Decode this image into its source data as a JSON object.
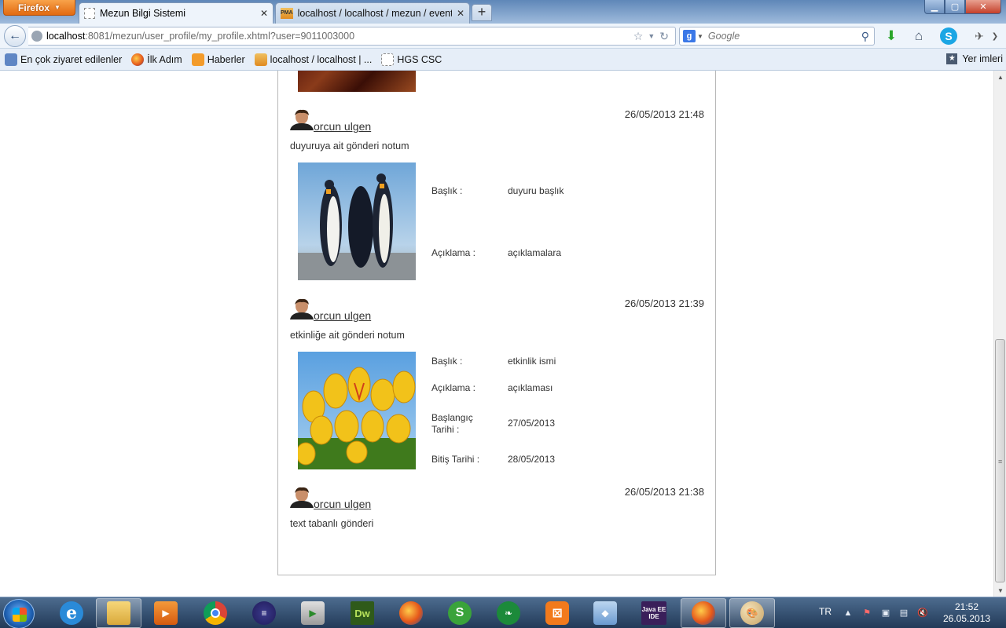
{
  "browser": {
    "firefox_label": "Firefox",
    "tabs": [
      {
        "title": "Mezun Bilgi Sistemi",
        "active": true
      },
      {
        "title": "localhost / localhost / mezun / event ...",
        "active": false
      }
    ],
    "url_host": "localhost",
    "url_rest": ":8081/mezun/user_profile/my_profile.xhtml?user=9011003000",
    "search_placeholder": "Google",
    "bookmarks": [
      {
        "label": "En çok ziyaret edilenler",
        "icon": "most-visited-icon"
      },
      {
        "label": "İlk Adım",
        "icon": "firefox-icon"
      },
      {
        "label": "Haberler",
        "icon": "rss-icon"
      },
      {
        "label": "localhost / localhost | ...",
        "icon": "phpmyadmin-icon"
      },
      {
        "label": "HGS CSC",
        "icon": "blank-page-icon"
      }
    ],
    "bookmarks_menu": "Yer imleri"
  },
  "feed": {
    "posts": [
      {
        "author": "orcun ulgen",
        "timestamp": "26/05/2013 21:48",
        "text": "duyuruya ait gönderi notum",
        "image": "penguins",
        "fields": [
          {
            "label": "Başlık :",
            "value": "duyuru başlık"
          },
          {
            "label": "Açıklama :",
            "value": "açıklamalara"
          }
        ]
      },
      {
        "author": "orcun ulgen",
        "timestamp": "26/05/2013 21:39",
        "text": "etkinliğe ait gönderi notum",
        "image": "tulips",
        "fields": [
          {
            "label": "Başlık :",
            "value": "etkinlik ismi"
          },
          {
            "label": "Açıklama :",
            "value": "açıklaması"
          },
          {
            "label": "Başlangıç Tarihi :",
            "value": "27/05/2013"
          },
          {
            "label": "Bitiş Tarihi :",
            "value": "28/05/2013"
          }
        ]
      },
      {
        "author": "orcun ulgen",
        "timestamp": "26/05/2013 21:38",
        "text": "text tabanlı gönderi"
      }
    ]
  },
  "taskbar": {
    "language": "TR",
    "time": "21:52",
    "date": "26.05.2013",
    "java_ee_label": "Java EE IDE",
    "dw_label": "Dw"
  },
  "colors": {
    "accent_firefox": "#e26a10",
    "titlebar": "#6f94c2",
    "taskbar": "#2f4a6c"
  }
}
